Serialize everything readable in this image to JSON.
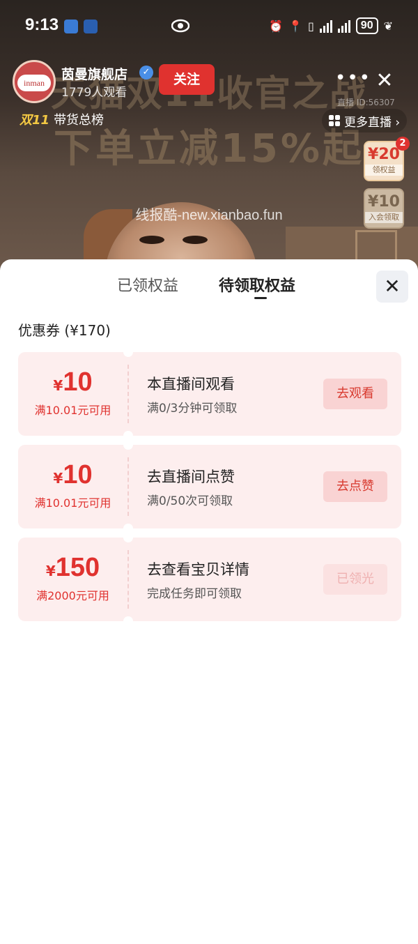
{
  "status_bar": {
    "time": "9:13",
    "battery": "90"
  },
  "live": {
    "banner_line1": "天猫双11收官之战",
    "banner_line2": "下单立减15%起",
    "watermark": "线报酷-new.xianbao.fun",
    "avatar_text": "inman",
    "shop_name": "茵曼旗舰店",
    "viewers": "1779人观看",
    "follow_label": "关注",
    "rank_tag": "双11",
    "rank_label": "带货总榜",
    "live_id": "直播 ID:56307",
    "more_live_label": "更多直播 ›",
    "more_icon": "ellipsis-icon",
    "close_icon": "close-icon",
    "side_coupons": [
      {
        "amount": "¥20",
        "label": "领权益",
        "badge": "2"
      },
      {
        "amount": "¥10",
        "label": "入会领取"
      }
    ]
  },
  "sheet": {
    "tabs": [
      {
        "label": "已领权益",
        "active": false
      },
      {
        "label": "待领取权益",
        "active": true
      }
    ],
    "close_icon": "close-icon",
    "section_title": "优惠券 (¥170)",
    "coupons": [
      {
        "currency": "¥",
        "amount": "10",
        "condition": "满10.01元可用",
        "task": "本直播间观看",
        "requirement": "满0/3分钟可领取",
        "action": "去观看",
        "action_enabled": true
      },
      {
        "currency": "¥",
        "amount": "10",
        "condition": "满10.01元可用",
        "task": "去直播间点赞",
        "requirement": "满0/50次可领取",
        "action": "去点赞",
        "action_enabled": true
      },
      {
        "currency": "¥",
        "amount": "150",
        "condition": "满2000元可用",
        "task": "去查看宝贝详情",
        "requirement": "完成任务即可领取",
        "action": "已领光",
        "action_enabled": false
      }
    ]
  },
  "colors": {
    "accent_red": "#e0322f",
    "coupon_bg": "#fdeeee",
    "action_bg": "#f9d3d3"
  }
}
